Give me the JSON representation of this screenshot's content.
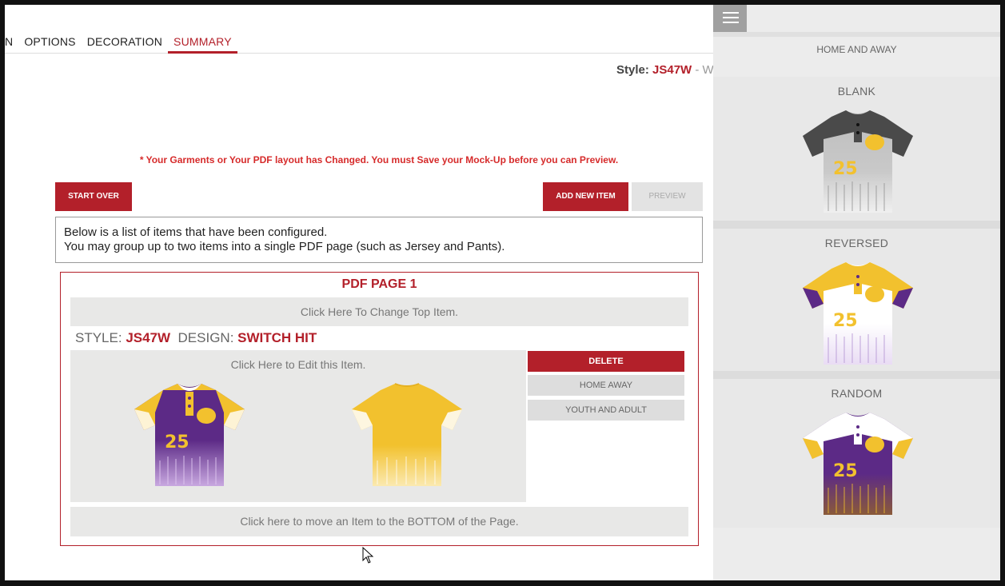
{
  "tabs": [
    {
      "label": "N",
      "active": false
    },
    {
      "label": "OPTIONS",
      "active": false
    },
    {
      "label": "DECORATION",
      "active": false
    },
    {
      "label": "SUMMARY",
      "active": true
    }
  ],
  "style_line": {
    "prefix": "Style: ",
    "code": "JS47W",
    "rest": " - W"
  },
  "warning": "* Your Garments or Your PDF layout has Changed. You must Save your Mock-Up before you can Preview.",
  "buttons": {
    "start_over": "START OVER",
    "add_new_item": "ADD NEW ITEM",
    "preview": "PREVIEW"
  },
  "info": {
    "line1": "Below is a list of items that have been configured.",
    "line2": "You may group up to two items into a single PDF page (such as Jersey and Pants)."
  },
  "pdf_page": {
    "title": "PDF PAGE 1",
    "change_top": "Click Here To Change Top Item.",
    "style_label": "STYLE: ",
    "style_value": "JS47W",
    "design_label": "DESIGN: ",
    "design_value": "SWITCH HIT",
    "edit_label": "Click Here to Edit this Item.",
    "actions": {
      "delete": "DELETE",
      "home_away": "HOME AWAY",
      "youth_adult": "YOUTH AND ADULT"
    },
    "move_bottom": "Click here to move an Item to the BOTTOM of the Page.",
    "jersey_number": "25"
  },
  "panel": {
    "header": "HOME AND AWAY",
    "options": [
      {
        "label": "BLANK",
        "number": "25"
      },
      {
        "label": "REVERSED",
        "number": "25"
      },
      {
        "label": "RANDOM",
        "number": "25"
      }
    ]
  },
  "colors": {
    "brand_red": "#b3202a",
    "purple": "#5c2a86",
    "gold": "#f2c12e",
    "charcoal": "#4a4a4a",
    "silver": "#c9c9c9"
  }
}
